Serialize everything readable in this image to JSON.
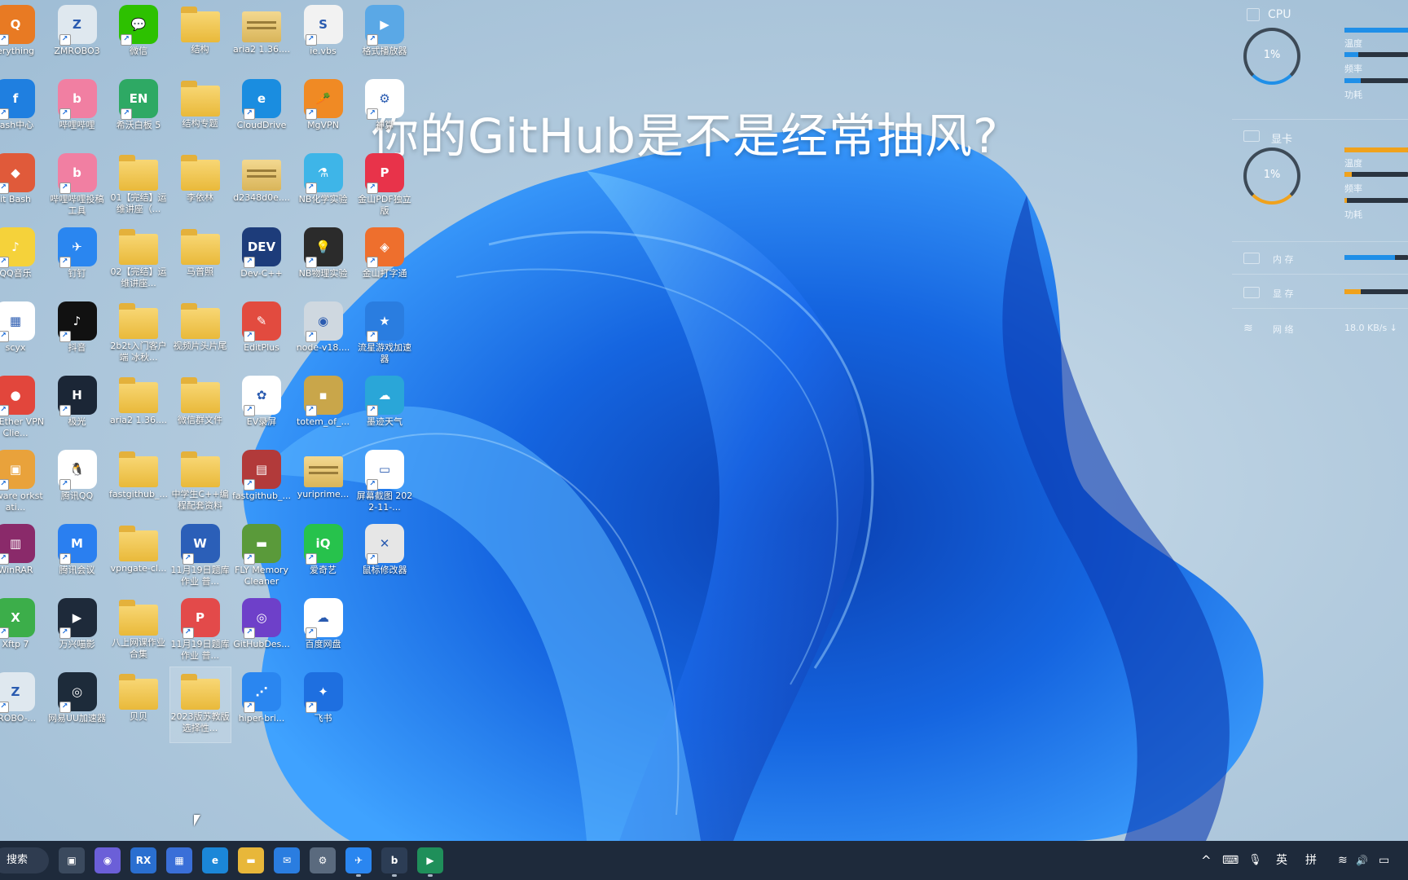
{
  "overlay_caption": "你的GitHub是不是经常抽风?",
  "desktop_icons": [
    {
      "label": "erything",
      "kind": "app",
      "color": "#e87a23",
      "glyph": "Q"
    },
    {
      "label": "ZMROBO3",
      "kind": "app",
      "color": "#dfe8ef",
      "glyph": "Z"
    },
    {
      "label": "微信",
      "kind": "app",
      "color": "#2dc100",
      "glyph": "💬"
    },
    {
      "label": "结构",
      "kind": "folder"
    },
    {
      "label": "aria2 1.36....",
      "kind": "zip"
    },
    {
      "label": "ie.vbs",
      "kind": "app",
      "color": "#f2f2f2",
      "glyph": "S"
    },
    {
      "label": "格式播放器",
      "kind": "app",
      "color": "#5aa8e6",
      "glyph": "▶"
    },
    {
      "label": "lash中心",
      "kind": "app",
      "color": "#1f7fe0",
      "glyph": "f"
    },
    {
      "label": "哔哩哔哩",
      "kind": "app",
      "color": "#f17fa2",
      "glyph": "b"
    },
    {
      "label": "希沃白板 5",
      "kind": "app",
      "color": "#2ea964",
      "glyph": "EN"
    },
    {
      "label": "结构专题",
      "kind": "folder"
    },
    {
      "label": "CloudDrive",
      "kind": "app",
      "color": "#1a8de0",
      "glyph": "e"
    },
    {
      "label": "MgVPN",
      "kind": "app",
      "color": "#f08a24",
      "glyph": "🥕"
    },
    {
      "label": "神算",
      "kind": "app",
      "color": "#ffffff",
      "glyph": "⚙"
    },
    {
      "label": "it Bash",
      "kind": "app",
      "color": "#e05a3a",
      "glyph": "◆"
    },
    {
      "label": "哔哩哔哩投稿工具",
      "kind": "app",
      "color": "#f17fa2",
      "glyph": "b"
    },
    {
      "label": "01【完结】运维讲座（...",
      "kind": "folder"
    },
    {
      "label": "李依林",
      "kind": "folder"
    },
    {
      "label": "d2348d0e....",
      "kind": "zip"
    },
    {
      "label": "NB化学实验",
      "kind": "app",
      "color": "#3eb5e8",
      "glyph": "⚗"
    },
    {
      "label": "金山PDF独立版",
      "kind": "app",
      "color": "#e8334a",
      "glyph": "P"
    },
    {
      "label": "QQ音乐",
      "kind": "app",
      "color": "#f5d23a",
      "glyph": "♪"
    },
    {
      "label": "钉钉",
      "kind": "app",
      "color": "#2a86f0",
      "glyph": "✈"
    },
    {
      "label": "02【完结】运维讲座...",
      "kind": "folder"
    },
    {
      "label": "马普照",
      "kind": "folder"
    },
    {
      "label": "Dev-C++",
      "kind": "app",
      "color": "#1d3c7a",
      "glyph": "DEV"
    },
    {
      "label": "NB物理实验",
      "kind": "app",
      "color": "#2b2b2b",
      "glyph": "💡"
    },
    {
      "label": "金山打字通",
      "kind": "app",
      "color": "#ee6f2d",
      "glyph": "◈"
    },
    {
      "label": "scyx",
      "kind": "app",
      "color": "#ffffff",
      "glyph": "▦"
    },
    {
      "label": "抖音",
      "kind": "app",
      "color": "#111111",
      "glyph": "♪"
    },
    {
      "label": "2b2t入门客户端 冰秋...",
      "kind": "folder"
    },
    {
      "label": "视频片头片尾",
      "kind": "folder"
    },
    {
      "label": "EditPlus",
      "kind": "app",
      "color": "#e24b3f",
      "glyph": "✎"
    },
    {
      "label": "node-v18....",
      "kind": "app",
      "color": "#cfd8e0",
      "glyph": "◉"
    },
    {
      "label": "流星游戏加速器",
      "kind": "app",
      "color": "#2a7de0",
      "glyph": "★"
    },
    {
      "label": "oftEther VPN Clie...",
      "kind": "app",
      "color": "#e2463c",
      "glyph": "●"
    },
    {
      "label": "极光",
      "kind": "app",
      "color": "#1b2636",
      "glyph": "H"
    },
    {
      "label": "aria2 1.36....",
      "kind": "folder"
    },
    {
      "label": "微信群文件",
      "kind": "folder"
    },
    {
      "label": "EV录屏",
      "kind": "app",
      "color": "#ffffff",
      "glyph": "✿"
    },
    {
      "label": "totem_of_...",
      "kind": "app",
      "color": "#c9a64a",
      "glyph": "▪"
    },
    {
      "label": "墨迹天气",
      "kind": "app",
      "color": "#2aa6d8",
      "glyph": "☁"
    },
    {
      "label": "Mware orkstati...",
      "kind": "app",
      "color": "#e9a23b",
      "glyph": "▣"
    },
    {
      "label": "腾讯QQ",
      "kind": "app",
      "color": "#ffffff",
      "glyph": "🐧"
    },
    {
      "label": "fastgithub_...",
      "kind": "folder"
    },
    {
      "label": "中学生C++编程配套资料",
      "kind": "folder"
    },
    {
      "label": "fastgithub_...",
      "kind": "app",
      "color": "#b23a3a",
      "glyph": "▤"
    },
    {
      "label": "yuriprime...",
      "kind": "zip"
    },
    {
      "label": "屏幕截图 2022-11-...",
      "kind": "app",
      "color": "#ffffff",
      "glyph": "▭"
    },
    {
      "label": "WinRAR",
      "kind": "app",
      "color": "#8a2a6a",
      "glyph": "▥"
    },
    {
      "label": "腾讯会议",
      "kind": "app",
      "color": "#2a7ff0",
      "glyph": "M"
    },
    {
      "label": "vpngate-cl...",
      "kind": "folder"
    },
    {
      "label": "11月19日题库作业 普...",
      "kind": "app",
      "color": "#2b5fb8",
      "glyph": "W"
    },
    {
      "label": "FLY Memory Cleaner",
      "kind": "app",
      "color": "#5a9a3a",
      "glyph": "▬"
    },
    {
      "label": "爱奇艺",
      "kind": "app",
      "color": "#27c24c",
      "glyph": "iQ"
    },
    {
      "label": "鼠标修改器",
      "kind": "app",
      "color": "#e6e6e6",
      "glyph": "✕"
    },
    {
      "label": "Xftp 7",
      "kind": "app",
      "color": "#3cae4a",
      "glyph": "X"
    },
    {
      "label": "万兴喵影",
      "kind": "app",
      "color": "#1e2a3a",
      "glyph": "▶"
    },
    {
      "label": "八上网课作业合集",
      "kind": "folder"
    },
    {
      "label": "11月19日题库作业 普...",
      "kind": "app",
      "color": "#e34a4a",
      "glyph": "P"
    },
    {
      "label": "GitHubDes...",
      "kind": "app",
      "color": "#6e40c9",
      "glyph": "◎"
    },
    {
      "label": "百度网盘",
      "kind": "app",
      "color": "#ffffff",
      "glyph": "☁"
    },
    {
      "label": "",
      "kind": "none"
    },
    {
      "label": "IROBO-...",
      "kind": "app",
      "color": "#dfe8ef",
      "glyph": "Z"
    },
    {
      "label": "网易UU加速器",
      "kind": "app",
      "color": "#1d2b3a",
      "glyph": "◎"
    },
    {
      "label": "贝贝",
      "kind": "folder"
    },
    {
      "label": "2023版苏教版选择性...",
      "kind": "folder",
      "selected": true
    },
    {
      "label": "hiper-bri...",
      "kind": "app",
      "color": "#2a86f0",
      "glyph": "⋰"
    },
    {
      "label": "飞书",
      "kind": "app",
      "color": "#1e6fe0",
      "glyph": "✦"
    },
    {
      "label": "",
      "kind": "none"
    }
  ],
  "monitor": {
    "cpu": {
      "title": "CPU",
      "percent": "1%",
      "rows": [
        {
          "label": "温度",
          "fill": 0.55
        },
        {
          "label": "频率",
          "fill": 0.22
        },
        {
          "label": "功耗",
          "fill": 0.25
        }
      ],
      "gauge_fill": 0.01
    },
    "gpu": {
      "title": "显卡",
      "percent": "1%",
      "rows": [
        {
          "label": "温度",
          "fill": 0.6
        },
        {
          "label": "频率",
          "fill": 0.12
        },
        {
          "label": "功耗",
          "fill": 0.04
        }
      ],
      "gauge_fill": 0.01
    },
    "mem": {
      "label": "内 存",
      "fill": 0.8
    },
    "vram": {
      "label": "显 存",
      "fill": 0.25
    },
    "net": {
      "label": "网 络",
      "value": "18.0 KB/s ↓"
    },
    "colors": {
      "cpu": "#1f8fe8",
      "gpu": "#f0a21c",
      "mem": "#1f8fe8",
      "vram": "#f0a21c"
    }
  },
  "taskbar": {
    "search_label": "搜索",
    "pinned": [
      {
        "name": "task-view",
        "glyph": "▣",
        "color": "#3b4a5e"
      },
      {
        "name": "chat",
        "glyph": "◉",
        "color": "#6b5fd8"
      },
      {
        "name": "rx-app",
        "glyph": "RX",
        "color": "#2a6fd0"
      },
      {
        "name": "store",
        "glyph": "▦",
        "color": "#3a6fd8"
      },
      {
        "name": "edge",
        "glyph": "e",
        "color": "#1b87d8"
      },
      {
        "name": "explorer",
        "glyph": "▬",
        "color": "#e8b73a"
      },
      {
        "name": "mail",
        "glyph": "✉",
        "color": "#2a7de0"
      },
      {
        "name": "settings",
        "glyph": "⚙",
        "color": "#5a6a7e"
      },
      {
        "name": "feather-app",
        "glyph": "✈",
        "color": "#2a86f0",
        "active": true
      },
      {
        "name": "bilibili",
        "glyph": "b",
        "color": "#2c3d55",
        "active": true
      },
      {
        "name": "sliding-app",
        "glyph": "▶",
        "color": "#1f8f5a",
        "active": true
      }
    ],
    "tray": {
      "chevron": "^",
      "keyboard": "⌨",
      "mic": "🎙",
      "lang": "英",
      "ime": "拼",
      "wifi": "≋",
      "volume": "🔊",
      "battery": "▭"
    }
  }
}
